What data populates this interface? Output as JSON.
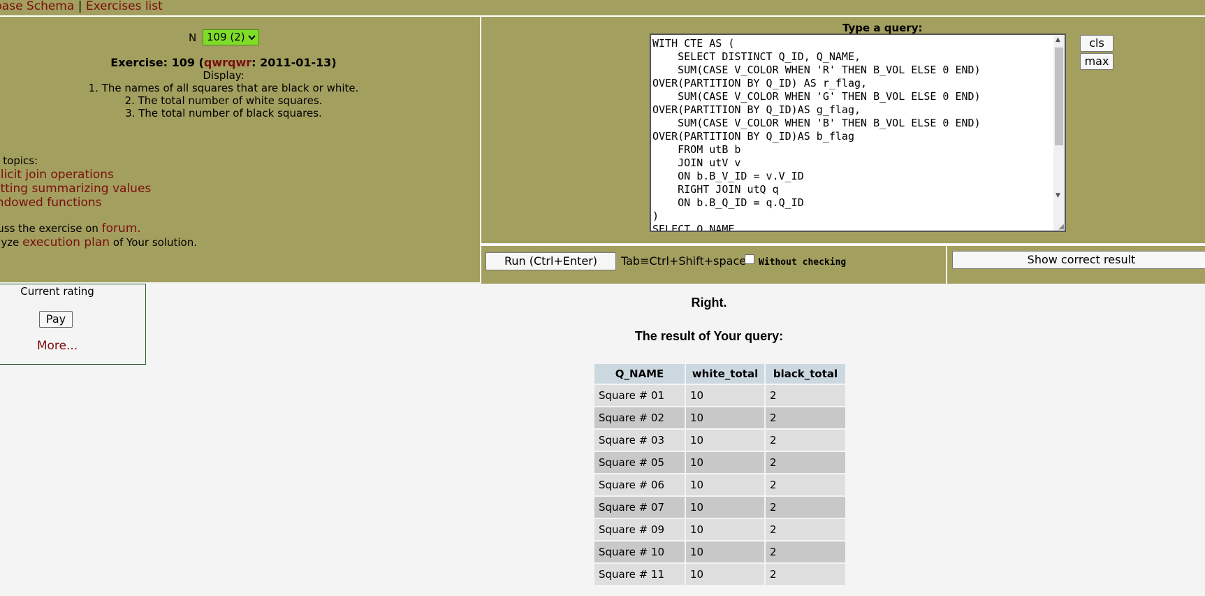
{
  "nav": {
    "schema_link": "base Schema",
    "separator": "|",
    "exercises_link": "Exercises list"
  },
  "exercise": {
    "n_label": "N",
    "n_selected": "109 (2)",
    "heading_prefix": "Exercise: 109 (",
    "author": "qwrqwr",
    "heading_suffix": ": 2011-01-13)",
    "display_label": "Display:",
    "items": [
      "1. The names of all squares that are black or white.",
      "2. The total number of white squares.",
      "3. The total number of black squares."
    ]
  },
  "help": {
    "label": "p topics:",
    "topics": [
      "plicit join operations",
      "etting summarizing values",
      "indowed functions"
    ],
    "discuss_prefix": "cuss the exercise on ",
    "forum_link": "forum.",
    "analyze_prefix": "alyze ",
    "plan_link": "execution plan",
    "analyze_suffix": " of Your solution."
  },
  "query": {
    "title": "Type a query:",
    "text": "WITH CTE AS (\n    SELECT DISTINCT Q_ID, Q_NAME,\n    SUM(CASE V_COLOR WHEN 'R' THEN B_VOL ELSE 0 END)\nOVER(PARTITION BY Q_ID) AS r_flag,\n    SUM(CASE V_COLOR WHEN 'G' THEN B_VOL ELSE 0 END)\nOVER(PARTITION BY Q_ID)AS g_flag,\n    SUM(CASE V_COLOR WHEN 'B' THEN B_VOL ELSE 0 END)\nOVER(PARTITION BY Q_ID)AS b_flag\n    FROM utB b\n    JOIN utV v\n    ON b.B_V_ID = v.V_ID\n    RIGHT JOIN utQ q\n    ON b.B_Q_ID = q.Q_ID\n)\nSELECT Q_NAME,",
    "cls_label": "cls",
    "max_label": "max"
  },
  "controls": {
    "run_label": "Run (Ctrl+Enter)",
    "tab_hint": "Tab≡Ctrl+Shift+space",
    "without_checking": "Without checking",
    "show_correct": "Show correct result"
  },
  "rating": {
    "title": "Current rating",
    "pay_label": "Pay",
    "more_link": "More..."
  },
  "result": {
    "status": "Right.",
    "title": "The result of Your query:",
    "columns": [
      "Q_NAME",
      "white_total",
      "black_total"
    ],
    "rows": [
      [
        "Square # 01",
        "10",
        "2"
      ],
      [
        "Square # 02",
        "10",
        "2"
      ],
      [
        "Square # 03",
        "10",
        "2"
      ],
      [
        "Square # 05",
        "10",
        "2"
      ],
      [
        "Square # 06",
        "10",
        "2"
      ],
      [
        "Square # 07",
        "10",
        "2"
      ],
      [
        "Square # 09",
        "10",
        "2"
      ],
      [
        "Square # 10",
        "10",
        "2"
      ],
      [
        "Square # 11",
        "10",
        "2"
      ]
    ]
  },
  "colors": {
    "panel_bg": "#a39f5f",
    "link": "#7a0f0f",
    "select_bg": "#7fdd2a",
    "header_bg": "#ccd8e0"
  }
}
